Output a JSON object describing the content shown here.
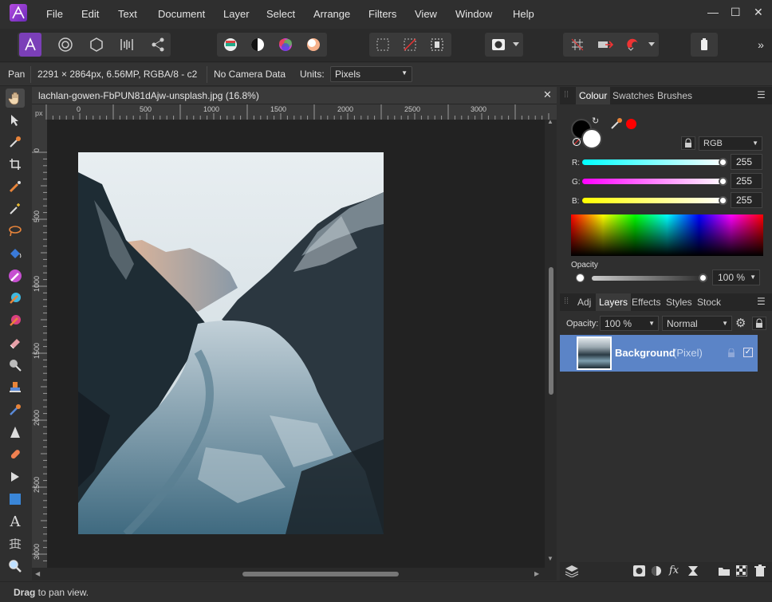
{
  "menu": [
    "File",
    "Edit",
    "Text",
    "Document",
    "Layer",
    "Select",
    "Arrange",
    "Filters",
    "View",
    "Window",
    "Help"
  ],
  "window_controls": {
    "minimize": "—",
    "maximize": "☐",
    "close": "✕"
  },
  "context": {
    "tool": "Pan",
    "doc_info": "2291 × 2864px, 6.56MP, RGBA/8 - c2",
    "camera": "No Camera Data",
    "units_label": "Units:",
    "units_value": "Pixels"
  },
  "document": {
    "tab_title": "lachlan-gowen-FbPUN81dAjw-unsplash.jpg (16.8%)",
    "ruler_unit": "px",
    "ruler_top": [
      "0",
      "500",
      "1000",
      "1500",
      "2000",
      "2500",
      "3000"
    ],
    "ruler_left": [
      "0",
      "500",
      "1000",
      "1500",
      "2000",
      "2500",
      "3000"
    ]
  },
  "colour_panel": {
    "tabs": [
      "Colour",
      "Swatches",
      "Brushes"
    ],
    "mode": "RGB",
    "r_label": "R:",
    "g_label": "G:",
    "b_label": "B:",
    "r": "255",
    "g": "255",
    "b": "255",
    "opacity_label": "Opacity",
    "opacity": "100 %"
  },
  "layers_panel": {
    "tabs": [
      "Adj",
      "Layers",
      "Effects",
      "Styles",
      "Stock"
    ],
    "opacity_label": "Opacity:",
    "opacity": "100 %",
    "blend": "Normal",
    "layer_name": "Background",
    "layer_type": "(Pixel)"
  },
  "status": {
    "bold": "Drag",
    "text": " to pan view."
  },
  "colors": {
    "accent": "#5b84c7",
    "panel": "#2f2f2f",
    "canvas": "#222222"
  }
}
